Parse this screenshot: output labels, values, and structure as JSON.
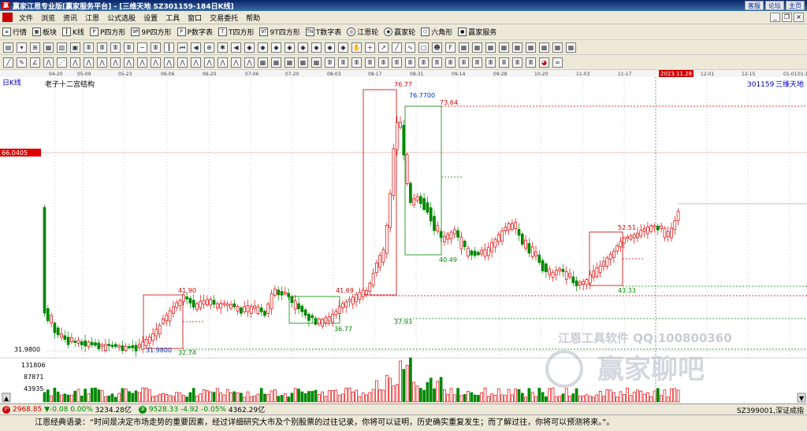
{
  "window": {
    "title": "赢家江恩专业版[赢家服务平台] - [三维天地  SZ301159-184日K线]",
    "right_buttons": [
      "客服",
      "论坛",
      "主页"
    ]
  },
  "menu": [
    "文件",
    "浏览",
    "资讯",
    "江恩",
    "公式选股",
    "设置",
    "工具",
    "窗口",
    "交易委托",
    "帮助"
  ],
  "toolbar1": [
    {
      "icon": "list-icon",
      "label": "行情"
    },
    {
      "icon": "grid-icon",
      "label": "板块"
    },
    {
      "icon": "candle-icon",
      "label": "K线"
    },
    {
      "icon": "p-icon",
      "label": "P四方形"
    },
    {
      "icon": "9p-icon",
      "label": "9P四方形"
    },
    {
      "icon": "p-icon",
      "label": "P数字表"
    },
    {
      "icon": "t-icon",
      "label": "T四方形"
    },
    {
      "icon": "9t-icon",
      "label": "9T四方形"
    },
    {
      "icon": "tn-icon",
      "label": "T数字表"
    },
    {
      "icon": "wheel-icon",
      "label": "江恩轮"
    },
    {
      "icon": "wheel-icon",
      "label": "赢家轮"
    },
    {
      "icon": "hexagon-icon",
      "label": "六角形"
    },
    {
      "icon": "service-icon",
      "label": "赢家服务"
    }
  ],
  "chart": {
    "period_label": "日K线",
    "indicator_label": "老子十二宫结构",
    "stock_code": "301159",
    "stock_name": "三维天地",
    "price_marker": "66.0405",
    "cursor_date": "2023.11.28",
    "dates": [
      "04-20",
      "05-09",
      "05-23",
      "06-06",
      "06-20",
      "07-06",
      "07-20",
      "08-03",
      "08-17",
      "08-31",
      "09-14",
      "09-28",
      "10-20",
      "11-03",
      "11-17",
      "12-01",
      "12-15",
      "01-01",
      "01-15"
    ],
    "annotations": {
      "high": "76.77",
      "high2": "76.7700",
      "a7364": "73.64",
      "a4190": "41.90",
      "a4169": "41.69",
      "a3677": "36.77",
      "a3793": "37.93",
      "a4049": "40.49",
      "a5251": "52.51",
      "a4333": "43.33",
      "a3198": "31.9800",
      "a3274": "32.74"
    },
    "yaxis": [
      "31.9800"
    ],
    "volume_axis": [
      "131806",
      "87871",
      "43935"
    ],
    "watermark1": "江恩工具软件 QQ:100800360",
    "watermark2": "赢家聊吧"
  },
  "status": {
    "sh_index": "2968.85",
    "sh_change": "▼-0.08",
    "sh_pct": "0.00%",
    "sh_amount": "3234.28亿",
    "sz_index": "9528.33",
    "sz_change": "-4.92",
    "sz_pct": "-0.05%",
    "sz_amount": "4362.29亿",
    "right_text": "SZ399001,深证成指"
  },
  "quote": "江恩经典语录：“时间是决定市场走势的重要因素，经过详细研究大市及个别股票的过往记录，你将可以证明，历史确实重复发生；而了解过往，你将可以预测将来。”。"
}
